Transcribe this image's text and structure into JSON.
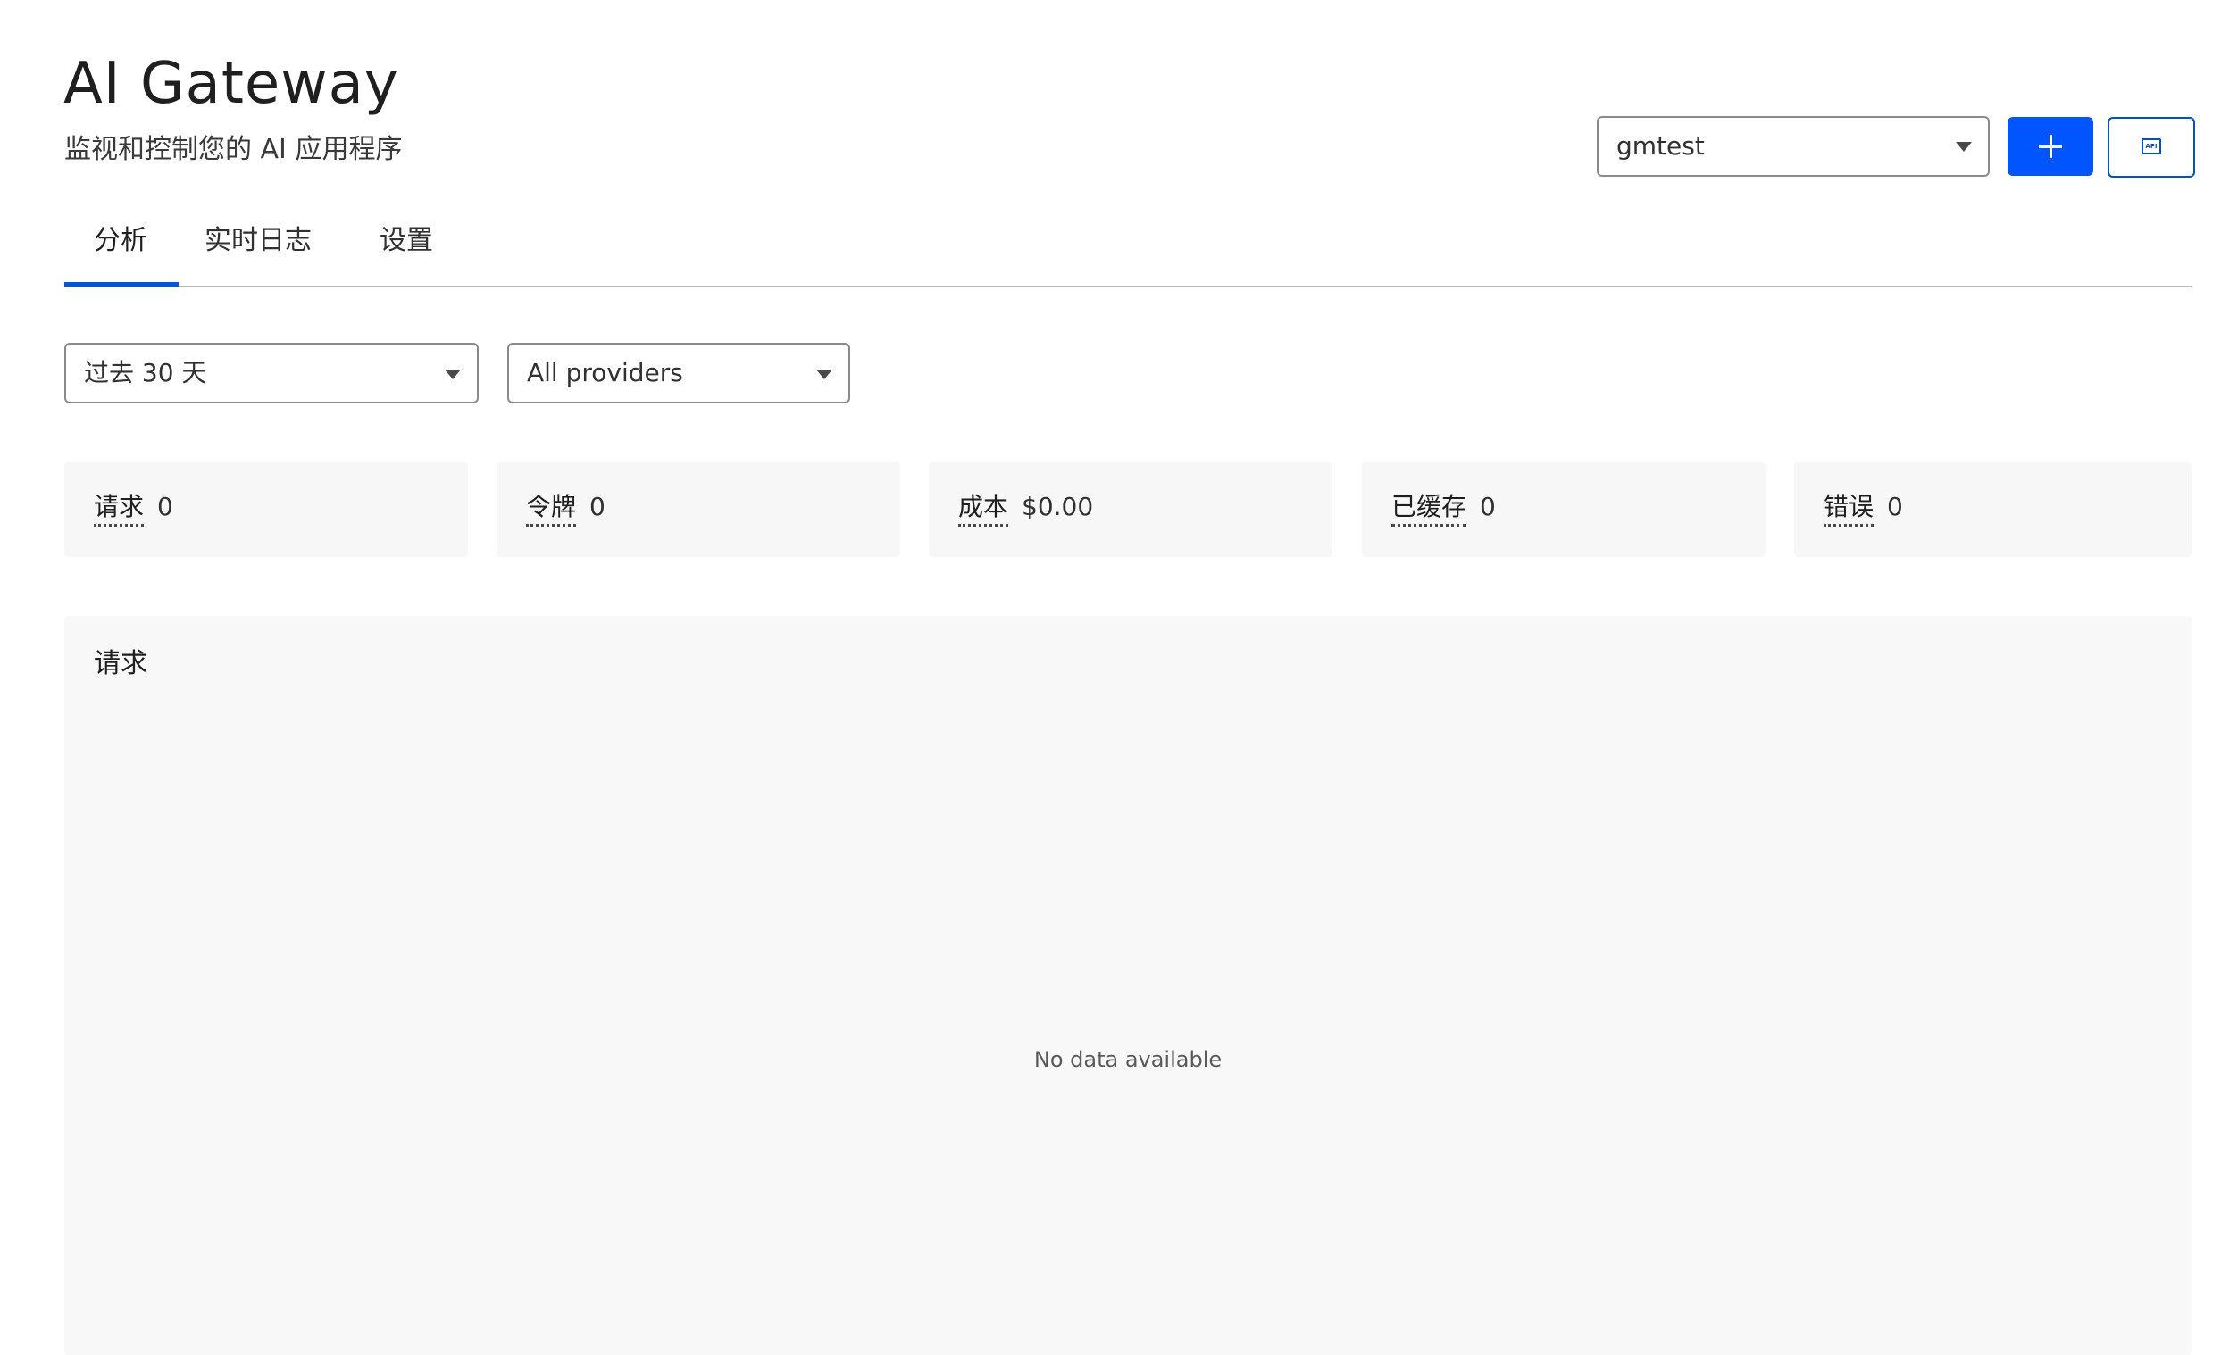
{
  "header": {
    "title": "AI Gateway",
    "subtitle": "监视和控制您的 AI 应用程序"
  },
  "toolbar": {
    "gateway_select_value": "gmtest",
    "add_icon": "plus-icon",
    "api_icon": "api-icon",
    "api_icon_text": "API",
    "accent_color": "#0055ff"
  },
  "tabs": [
    {
      "label": "分析",
      "active": true
    },
    {
      "label": "实时日志",
      "active": false
    },
    {
      "label": "设置",
      "active": false
    }
  ],
  "filters": {
    "time_range": "过去 30 天",
    "provider": "All providers"
  },
  "stats": [
    {
      "label": "请求",
      "value": "0"
    },
    {
      "label": "令牌",
      "value": "0"
    },
    {
      "label": "成本",
      "value": "$0.00"
    },
    {
      "label": "已缓存",
      "value": "0"
    },
    {
      "label": "错误",
      "value": "0"
    }
  ],
  "chart_panel": {
    "title": "请求",
    "empty_message": "No data available"
  }
}
